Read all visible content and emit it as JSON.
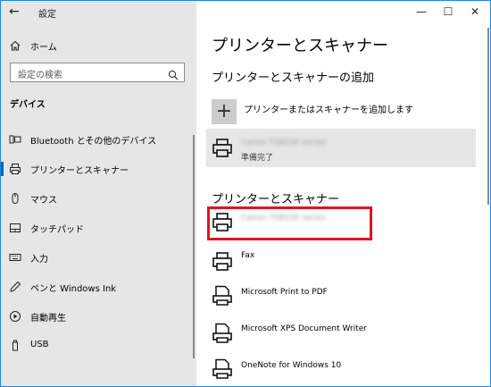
{
  "window": {
    "title": "設定",
    "minimize": "—",
    "maximize": "☐",
    "close": "✕"
  },
  "nav": {
    "back": "←"
  },
  "sidebar": {
    "home": "ホーム",
    "search_placeholder": "設定の検索",
    "category": "デバイス",
    "items": [
      {
        "label": "Bluetooth とその他のデバイス",
        "icon": "bluetooth-devices-icon"
      },
      {
        "label": "プリンターとスキャナー",
        "icon": "printer-icon",
        "active": true
      },
      {
        "label": "マウス",
        "icon": "mouse-icon"
      },
      {
        "label": "タッチパッド",
        "icon": "touchpad-icon"
      },
      {
        "label": "入力",
        "icon": "keyboard-icon"
      },
      {
        "label": "ペンと Windows Ink",
        "icon": "pen-icon"
      },
      {
        "label": "自動再生",
        "icon": "autoplay-icon"
      },
      {
        "label": "USB",
        "icon": "usb-icon"
      }
    ]
  },
  "main": {
    "title": "プリンターとスキャナー",
    "add_section_title": "プリンターとスキャナーの追加",
    "add_button_icon": "+",
    "add_label": "プリンターまたはスキャナーを追加します",
    "selected_printer": {
      "name": "Canon TS8330 series",
      "status": "準備完了"
    },
    "list_title": "プリンターとスキャナー",
    "printers": [
      {
        "name": "Canon TS8330 series",
        "blurred": true,
        "icon": "printer-icon"
      },
      {
        "name": "Fax",
        "icon": "fax-printer-icon"
      },
      {
        "name": "Microsoft Print to PDF",
        "icon": "virtual-printer-icon"
      },
      {
        "name": "Microsoft XPS Document Writer",
        "icon": "virtual-printer-icon"
      },
      {
        "name": "OneNote for Windows 10",
        "icon": "virtual-printer-icon"
      }
    ]
  },
  "colors": {
    "accent": "#0067b8",
    "highlight_box": "#e1141e",
    "sidebar_bg": "#e6e6e6"
  }
}
